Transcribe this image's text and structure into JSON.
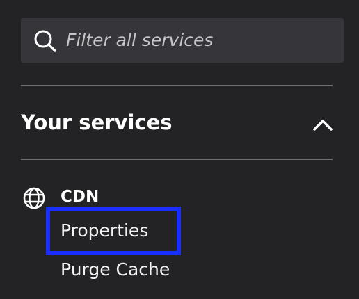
{
  "search": {
    "placeholder": "Filter all services",
    "icon": "search-icon"
  },
  "section": {
    "title": "Your services",
    "expanded": true,
    "toggle_icon": "chevron-up-icon"
  },
  "services": {
    "group_label": "CDN",
    "group_icon": "globe-icon",
    "items": [
      {
        "label": "Properties",
        "highlighted": true
      },
      {
        "label": "Purge Cache",
        "highlighted": false
      }
    ]
  },
  "colors": {
    "background": "#232325",
    "search_background": "#36363a",
    "divider": "#6e6e72",
    "highlight": "#1a2eff",
    "text": "#ffffff",
    "placeholder_text": "#c6c6c8"
  }
}
